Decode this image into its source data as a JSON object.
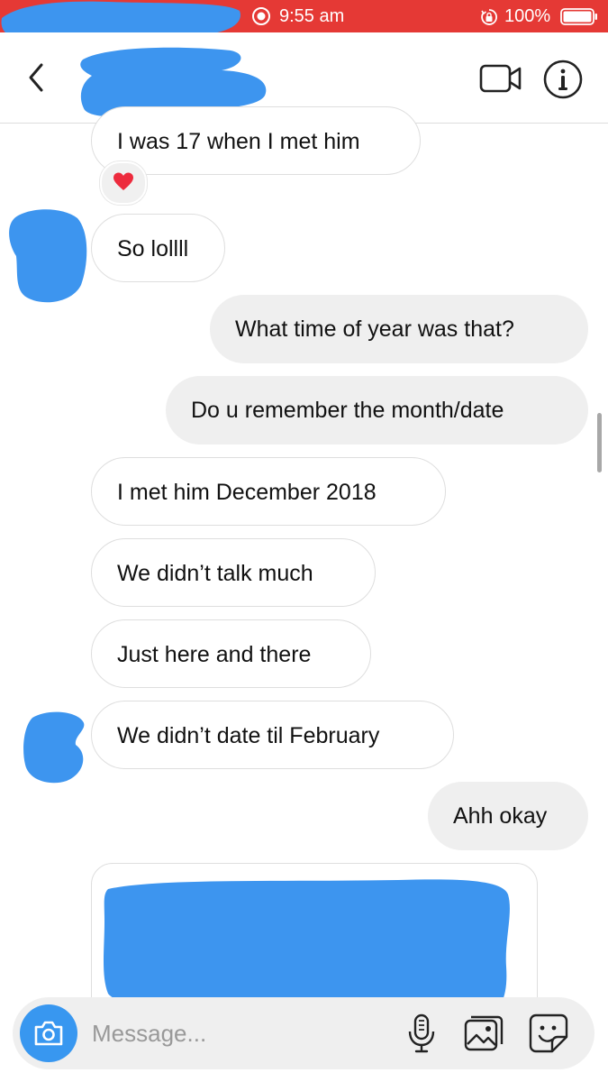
{
  "status_bar": {
    "time": "9:55 am",
    "battery": "100%",
    "background": "#e53935"
  },
  "header": {
    "back_icon": "chevron-left-icon",
    "video_icon": "video-call-icon",
    "info_icon": "info-icon"
  },
  "messages": [
    {
      "text": "I was 17 when I met him",
      "direction": "incoming"
    },
    {
      "text": "So lollll",
      "direction": "incoming"
    },
    {
      "text": "What time of year was that?",
      "direction": "outgoing"
    },
    {
      "text": "Do u remember the month/date",
      "direction": "outgoing"
    },
    {
      "text": "I met him December 2018",
      "direction": "incoming"
    },
    {
      "text": "We didn’t talk much",
      "direction": "incoming"
    },
    {
      "text": "Just here and there",
      "direction": "incoming"
    },
    {
      "text": "We didn’t date til February",
      "direction": "incoming"
    },
    {
      "text": "Ahh okay",
      "direction": "outgoing"
    }
  ],
  "reaction": "heart-icon",
  "composer": {
    "placeholder": "Message...",
    "accent": "#3897f0"
  },
  "colors": {
    "outgoing_bubble": "#efefef",
    "incoming_border": "#dedede",
    "redaction": "#3d95ef"
  }
}
